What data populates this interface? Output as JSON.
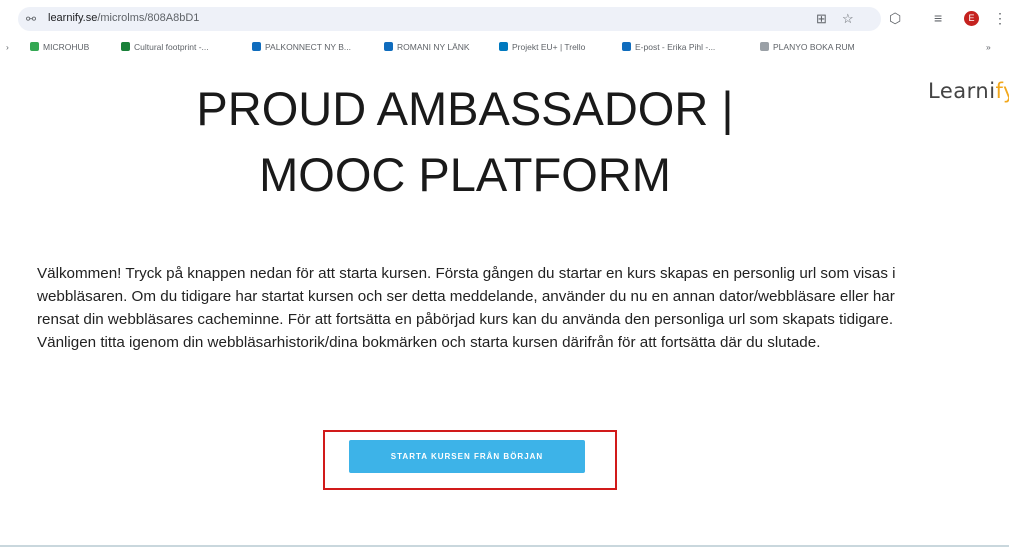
{
  "browser": {
    "url_domain": "learnify.se",
    "url_path": "/microlms/808A8bD1",
    "profile_initial": "E",
    "more_bookmarks": "»",
    "bookmarks": [
      {
        "label": "MICROHUB",
        "color": "#34a853"
      },
      {
        "label": "Cultural footprint -...",
        "color": "#188038"
      },
      {
        "label": "PALKONNECT NY B...",
        "color": "#0f6cbd"
      },
      {
        "label": "ROMANI NY LÄNK",
        "color": "#0f6cbd"
      },
      {
        "label": "Projekt EU+ | Trello",
        "color": "#0079bf"
      },
      {
        "label": "E-post - Erika Pihl -...",
        "color": "#0f6cbd"
      },
      {
        "label": "PLANYO BOKA RUM",
        "color": "#9aa0a6"
      }
    ]
  },
  "page": {
    "logo_main": "Learni",
    "logo_accent": "fy",
    "title_line1": "PROUD AMBASSADOR |",
    "title_line2": "MOOC PLATFORM",
    "intro": "Välkommen! Tryck på knappen nedan för att starta kursen. Första gången du startar en kurs skapas en personlig url som visas i webbläsaren. Om du tidigare har startat kursen och ser detta meddelande, använder du nu en annan dator/webbläsare eller har rensat din webbläsares cacheminne. För att fortsätta en påbörjad kurs kan du använda den personliga url som skapats tidigare. Vänligen titta igenom din webbläsarhistorik/dina bokmärken och starta kursen därifrån för att fortsätta där du slutade.",
    "start_button": "STARTA KURSEN FRÅN BÖRJAN"
  },
  "colors": {
    "button": "#3db3e8",
    "highlight_box": "#d11a1a",
    "logo_accent": "#f2a81d"
  }
}
